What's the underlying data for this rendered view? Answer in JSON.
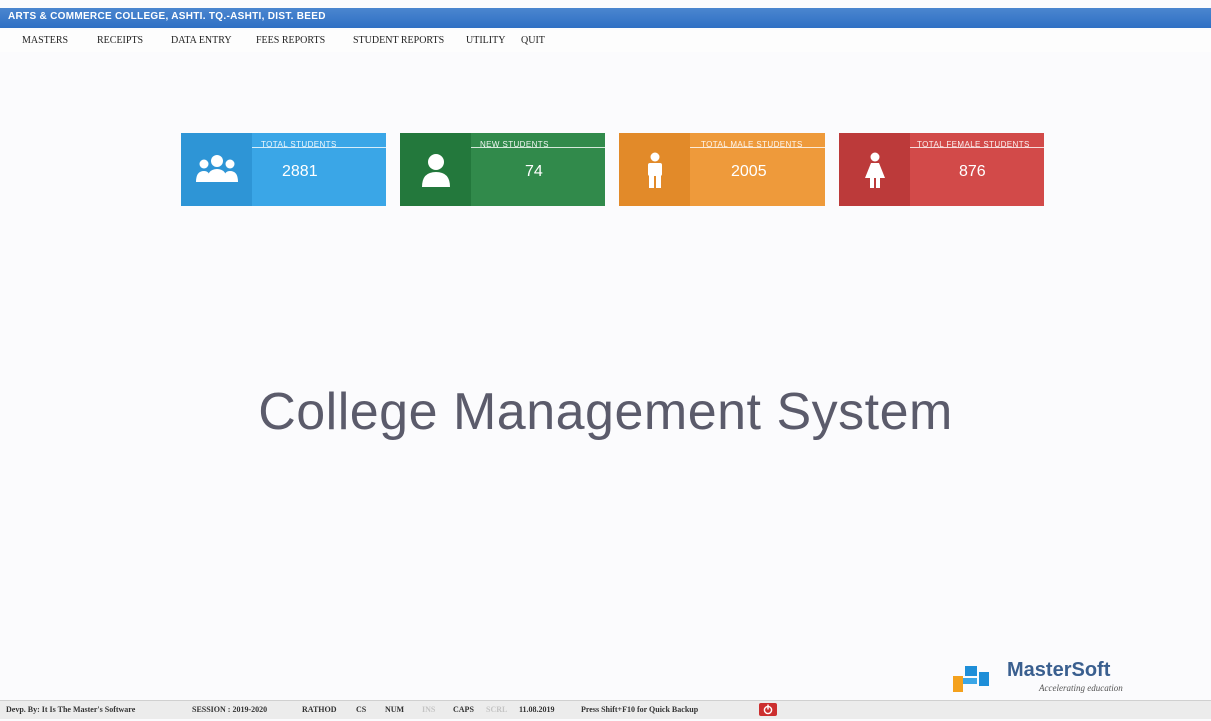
{
  "window": {
    "title": "ARTS & COMMERCE COLLEGE, ASHTI. TQ.-ASHTI, DIST. BEED"
  },
  "menu": [
    "MASTERS",
    "RECEIPTS",
    "DATA ENTRY",
    "FEES REPORTS",
    "STUDENT REPORTS",
    "UTILITY",
    "QUIT"
  ],
  "tiles": [
    {
      "label": "TOTAL STUDENTS",
      "value": "2881",
      "icon": "students-group-icon",
      "color": "#3aa6e7",
      "icon_bg": "#2e95d6"
    },
    {
      "label": "NEW STUDENTS",
      "value": "74",
      "icon": "user-icon",
      "color": "#318a4b",
      "icon_bg": "#23783c"
    },
    {
      "label": "TOTAL MALE STUDENTS",
      "value": "2005",
      "icon": "male-icon",
      "color": "#ee9a3b",
      "icon_bg": "#e28a29"
    },
    {
      "label": "TOTAL FEMALE STUDENTS",
      "value": "876",
      "icon": "female-icon",
      "color": "#d24a49",
      "icon_bg": "#bc3a3a"
    }
  ],
  "main_heading": "College Management System",
  "logo": {
    "brand": "MasterSoft",
    "tagline": "Accelerating education"
  },
  "statusbar": {
    "developer": "Devp. By: It Is The Master's Software",
    "session": "SESSION : 2019-2020",
    "user": "RATHOD",
    "cs": "CS",
    "num": "NUM",
    "ins": "INS",
    "caps": "CAPS",
    "scrl": "SCRL",
    "date": "11.08.2019",
    "hint": "Press Shift+F10 for Quick Backup"
  }
}
